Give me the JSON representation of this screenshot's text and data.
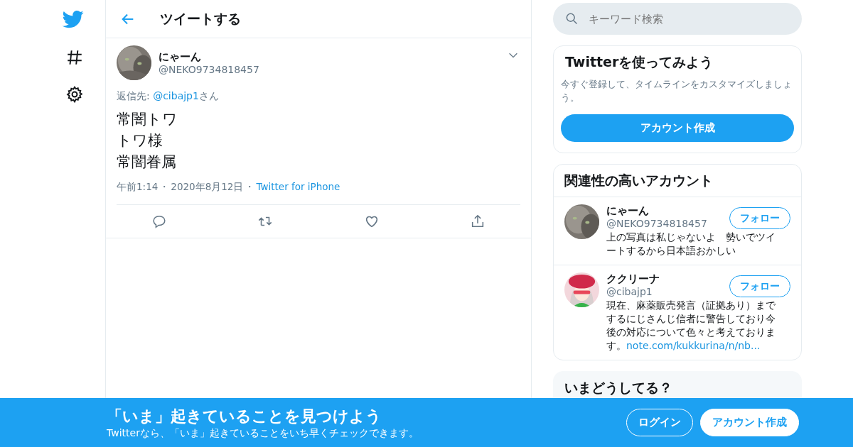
{
  "header": {
    "title": "ツイートする"
  },
  "search": {
    "placeholder": "キーワード検索"
  },
  "tweet": {
    "name": "にゃーん",
    "handle": "@NEKO9734818457",
    "reply_label": "返信先:",
    "reply_to": "@cibajp1",
    "reply_suffix": "さん",
    "lines": [
      "常闇トワ",
      "トワ様",
      "常闇眷属"
    ],
    "time": "午前1:14",
    "separator_1": "・",
    "date": "2020年8月12日",
    "separator_2": "・",
    "source": "Twitter for iPhone"
  },
  "signup_card": {
    "title": "Twitterを使ってみよう",
    "text": "今すぐ登録して、タイムラインをカスタマイズしましょう。",
    "button": "アカウント作成"
  },
  "related": {
    "title": "関連性の高いアカウント",
    "accounts": [
      {
        "name": "にゃーん",
        "handle": "@NEKO9734818457",
        "follow": "フォロー",
        "bio": "上の写真は私じゃないよ　勢いでツイートするから日本語おかしい"
      },
      {
        "name": "ククリーナ",
        "handle": "@cibajp1",
        "follow": "フォロー",
        "bio": "現在、麻薬販売発言（証拠あり）までするにじさんじ信者に警告しており今後の対応について色々と考えております。",
        "link": "note.com/kukkurina/n/nb..."
      }
    ]
  },
  "trends_card": {
    "title": "いまどうしてる？"
  },
  "banner": {
    "title": "「いま」起きていることを見つけよう",
    "subtitle": "Twitterなら、「いま」起きていることをいち早くチェックできます。",
    "login": "ログイン",
    "signup": "アカウント作成"
  }
}
